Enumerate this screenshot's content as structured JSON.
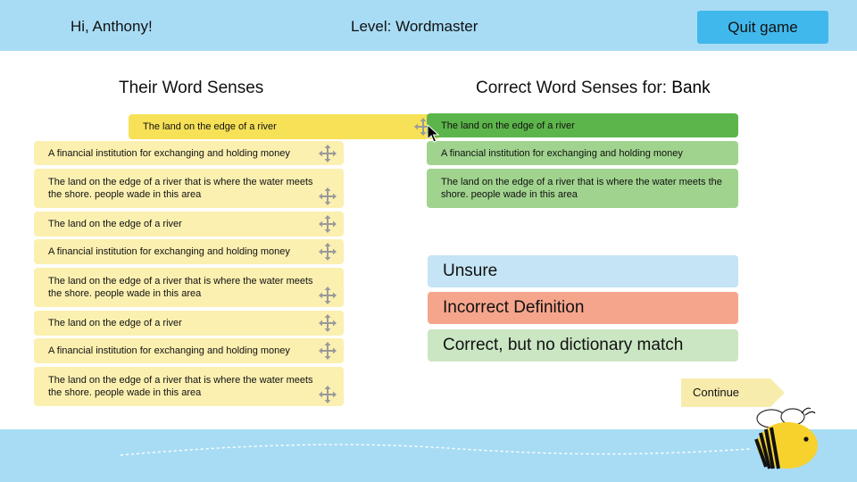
{
  "header": {
    "greeting": "Hi, Anthony!",
    "level": "Level: Wordmaster",
    "quit_label": "Quit game"
  },
  "left_panel": {
    "title": "Their Word Senses",
    "dragging_card": "The land on the edge of a river",
    "cards": [
      "A financial institution for exchanging and holding money",
      "The land on the edge of a river that is where the water meets the shore. people wade in this area",
      "The land on the edge of a river",
      "A financial institution for exchanging and holding money",
      "The land on the edge of a river that is where the water meets the shore. people wade in this area",
      "The land on the edge of a river",
      "A financial institution for exchanging and holding money",
      "The land on the edge of a river that is where the water meets the shore. people wade in this area"
    ]
  },
  "right_panel": {
    "title_prefix": "Correct Word Senses for:",
    "word": "Bank",
    "senses": [
      "The land on the edge of a river",
      "A financial institution for exchanging and holding money",
      "The land on the edge of a river that is where the water meets the shore. people wade in this area"
    ]
  },
  "choices": {
    "unsure": "Unsure",
    "incorrect": "Incorrect Definition",
    "correct_no_match": "Correct, but no dictionary match"
  },
  "continue_label": "Continue",
  "colors": {
    "header_bg": "#a8dcf5",
    "quit_btn": "#41b8ec",
    "card_yellow": "#fbf0b0",
    "card_dragging": "#f7e157",
    "sense_selected": "#5cb54a",
    "sense_default": "#a0d38e",
    "unsure": "#c5e4f5",
    "incorrect": "#f6a58d",
    "correct": "#cae6c3",
    "continue": "#f8ecad"
  },
  "icons": {
    "move": "move-arrows-icon",
    "cursor": "mouse-pointer-icon",
    "mascot": "bee-mascot-icon"
  }
}
